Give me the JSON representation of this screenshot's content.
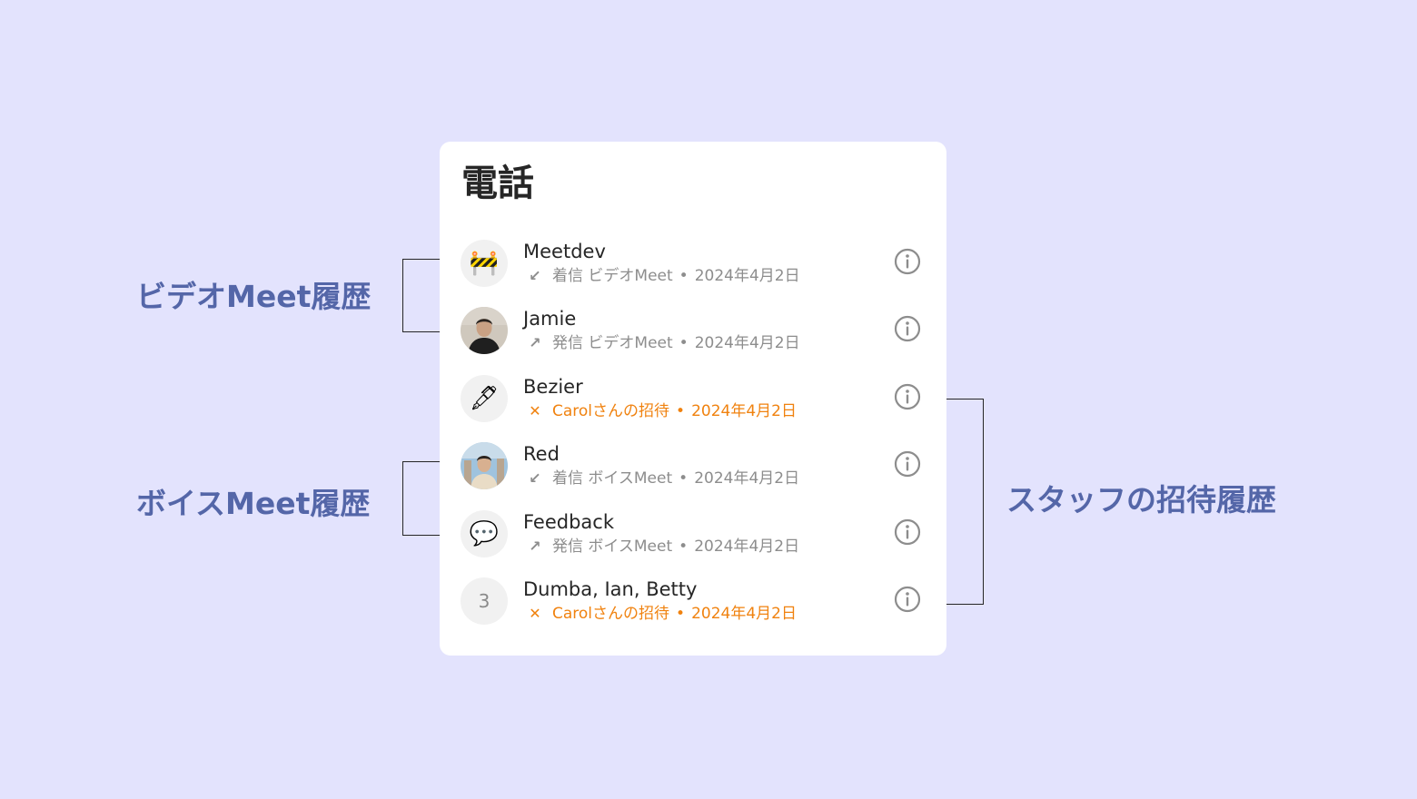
{
  "panel": {
    "title": "電話",
    "calls": [
      {
        "name": "Meetdev",
        "avatar": "construction-emoji",
        "direction": "incoming-arrow",
        "meta": "着信 ビデオMeet",
        "date": "2024年4月2日",
        "type": "normal"
      },
      {
        "name": "Jamie",
        "avatar": "photo-avatar",
        "direction": "outgoing-arrow",
        "meta": "発信 ビデオMeet",
        "date": "2024年4月2日",
        "type": "normal"
      },
      {
        "name": "Bezier",
        "avatar": "pen-emoji",
        "direction": "cross",
        "meta": "Carolさんの招待",
        "date": "2024年4月2日",
        "type": "invite"
      },
      {
        "name": "Red",
        "avatar": "photo-avatar",
        "direction": "incoming-arrow",
        "meta": "着信 ボイスMeet",
        "date": "2024年4月2日",
        "type": "normal"
      },
      {
        "name": "Feedback",
        "avatar": "speech-bubble-emoji",
        "direction": "outgoing-arrow",
        "meta": "発信 ボイスMeet",
        "date": "2024年4月2日",
        "type": "normal"
      },
      {
        "name": "Dumba, Ian, Betty",
        "avatar": "3",
        "direction": "cross",
        "meta": "Carolさんの招待",
        "date": "2024年4月2日",
        "type": "invite"
      }
    ],
    "separator": "•",
    "glyphs": {
      "incoming": "↙",
      "outgoing": "↗",
      "cross": "✕",
      "construction": "🚧",
      "pen": "🖋",
      "speech": "💬"
    }
  },
  "annotations": {
    "video": "ビデオMeet履歴",
    "voice": "ボイスMeet履歴",
    "invite": "スタッフの招待履歴"
  },
  "colors": {
    "background": "#e3e3fd",
    "label": "#5466a8",
    "invite": "#f0820f",
    "muted": "#8d8d8d",
    "text": "#262626"
  }
}
